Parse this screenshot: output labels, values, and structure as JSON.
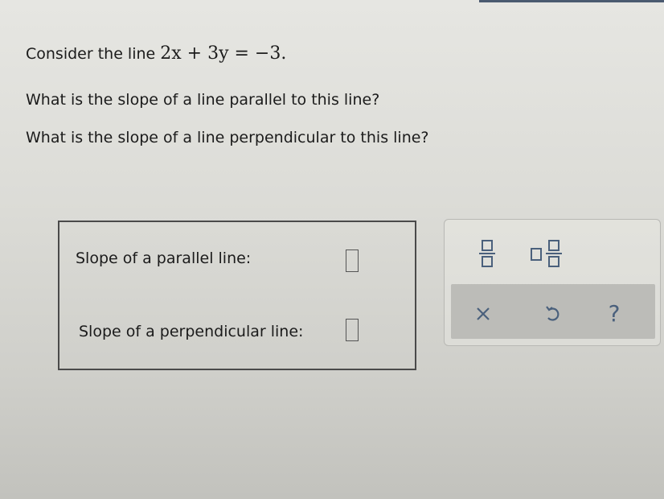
{
  "question": {
    "line1_prefix": "Consider the line ",
    "equation": "2x + 3y = −3.",
    "line2": "What is the slope of a line parallel to this line?",
    "line3": "What is the slope of a line perpendicular to this line?"
  },
  "answers": {
    "parallel_label": "Slope of a parallel line:",
    "parallel_value": "",
    "perpendicular_label": "Slope of a perpendicular line:",
    "perpendicular_value": ""
  },
  "toolbar": {
    "help_label": "?"
  },
  "colors": {
    "icon": "#4a607c",
    "border": "#4a4a4a"
  }
}
